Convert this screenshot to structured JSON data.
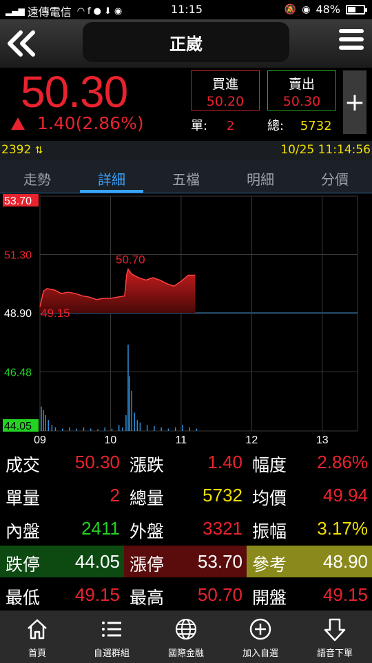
{
  "status": {
    "carrier": "遠傳電信",
    "time": "11:15",
    "battery": "48%",
    "battery_level": 48
  },
  "header": {
    "title": "正崴"
  },
  "quote": {
    "price": "50.30",
    "change": "1.40(2.86%)",
    "buy_label": "買進",
    "buy_price": "50.20",
    "sell_label": "賣出",
    "sell_price": "50.30",
    "plus": "+",
    "qty_label": "單:",
    "qty": "2",
    "total_label": "總:",
    "total": "5732"
  },
  "infobar": {
    "volume": "2392",
    "datetime": "10/25 11:14:56"
  },
  "tabs": [
    {
      "label": "走勢"
    },
    {
      "label": "詳細"
    },
    {
      "label": "五檔"
    },
    {
      "label": "明細"
    },
    {
      "label": "分價"
    }
  ],
  "chart_data": {
    "type": "area",
    "y_ticks": [
      "53.70",
      "51.30",
      "48.90",
      "46.48",
      "44.05"
    ],
    "x_ticks": [
      "09",
      "10",
      "11",
      "12",
      "13"
    ],
    "reference": 48.9,
    "ylim": [
      44.05,
      53.7
    ],
    "annotations": [
      {
        "text": "50.70",
        "x": 10.25,
        "y": 50.7
      },
      {
        "text": "49.15",
        "x": 9.0,
        "y": 49.15
      }
    ],
    "price_series": {
      "x": [
        9.0,
        9.05,
        9.1,
        9.2,
        9.3,
        9.4,
        9.5,
        9.6,
        9.7,
        9.8,
        9.9,
        10.0,
        10.1,
        10.2,
        10.23,
        10.25,
        10.3,
        10.4,
        10.5,
        10.6,
        10.7,
        10.8,
        10.9,
        11.0,
        11.1,
        11.2
      ],
      "y": [
        49.15,
        49.8,
        49.9,
        49.85,
        49.7,
        49.75,
        49.7,
        49.6,
        49.55,
        49.45,
        49.5,
        49.5,
        49.55,
        49.6,
        50.5,
        50.7,
        50.5,
        50.35,
        50.25,
        50.35,
        50.25,
        50.1,
        50.0,
        50.2,
        50.45,
        50.45
      ]
    },
    "volume_series": {
      "x": [
        9.0,
        9.03,
        9.06,
        9.1,
        9.15,
        9.2,
        9.3,
        9.4,
        9.5,
        9.6,
        9.7,
        9.8,
        9.9,
        10.0,
        10.1,
        10.15,
        10.2,
        10.23,
        10.25,
        10.28,
        10.32,
        10.36,
        10.4,
        10.5,
        10.6,
        10.7,
        10.8,
        10.9,
        11.0,
        11.1,
        11.2
      ],
      "y": [
        45.05,
        44.9,
        44.7,
        44.5,
        44.3,
        44.2,
        44.15,
        44.2,
        44.15,
        44.2,
        44.15,
        44.12,
        44.2,
        44.15,
        44.3,
        44.2,
        44.7,
        47.6,
        46.3,
        45.7,
        44.8,
        44.5,
        44.4,
        44.3,
        44.25,
        44.2,
        44.15,
        44.2,
        44.3,
        44.2,
        44.15
      ]
    }
  },
  "stats": [
    [
      {
        "key": "成交",
        "value": "50.30",
        "color": "red"
      },
      {
        "key": "漲跌",
        "value": "1.40",
        "color": "red"
      },
      {
        "key": "幅度",
        "value": "2.86%",
        "color": "red"
      }
    ],
    [
      {
        "key": "單量",
        "value": "2",
        "color": "red"
      },
      {
        "key": "總量",
        "value": "5732",
        "color": "yellow"
      },
      {
        "key": "均價",
        "value": "49.94",
        "color": "red"
      }
    ],
    [
      {
        "key": "內盤",
        "value": "2411",
        "color": "green"
      },
      {
        "key": "外盤",
        "value": "3321",
        "color": "red"
      },
      {
        "key": "振幅",
        "value": "3.17%",
        "color": "yellow"
      }
    ],
    [
      {
        "key": "跌停",
        "value": "44.05",
        "color": "white"
      },
      {
        "key": "漲停",
        "value": "53.70",
        "color": "white"
      },
      {
        "key": "參考",
        "value": "48.90",
        "color": "white"
      }
    ],
    [
      {
        "key": "最低",
        "value": "49.15",
        "color": "red"
      },
      {
        "key": "最高",
        "value": "50.70",
        "color": "red"
      },
      {
        "key": "開盤",
        "value": "49.15",
        "color": "red"
      }
    ]
  ],
  "nav": [
    {
      "label": "首頁",
      "icon": "home-icon"
    },
    {
      "label": "自選群組",
      "icon": "list-icon"
    },
    {
      "label": "國際金融",
      "icon": "globe-icon"
    },
    {
      "label": "加入自選",
      "icon": "add-circle-icon"
    },
    {
      "label": "語音下單",
      "icon": "arrow-down-icon"
    }
  ],
  "colors": {
    "up": "#e8232e",
    "down": "#23d223",
    "accent": "#3aa2ff",
    "limit_down_bg": "#0c4a12",
    "limit_up_bg": "#5a0b0b",
    "reference_bg": "#8a8a1c"
  }
}
